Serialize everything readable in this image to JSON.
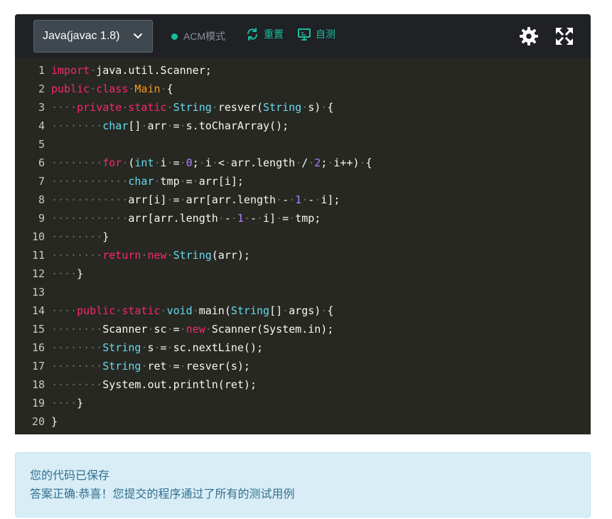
{
  "toolbar": {
    "language": "Java(javac 1.8)",
    "mode": "ACM模式",
    "reset_label": "重置",
    "selftest_label": "自测",
    "accent_color": "#1abc9c"
  },
  "editor": {
    "theme_background": "#272822",
    "lines": [
      {
        "n": "1",
        "html": "<span class=\"kw\">import</span><span class=\"ws\">·</span>java.util.Scanner;"
      },
      {
        "n": "2",
        "html": "<span class=\"kw\">public</span><span class=\"ws\">·</span><span class=\"kw\">class</span><span class=\"ws\">·</span><span class=\"cls\">Main</span><span class=\"ws\">·</span>{"
      },
      {
        "n": "3",
        "html": "<span class=\"ws\">····</span><span class=\"kw\">private</span><span class=\"ws\">·</span><span class=\"kw\">static</span><span class=\"ws\">·</span><span class=\"ty\">String</span><span class=\"ws\">·</span>resver(<span class=\"ty\">String</span><span class=\"ws\">·</span>s)<span class=\"ws\">·</span>{"
      },
      {
        "n": "4",
        "html": "<span class=\"ws\">········</span><span class=\"ty\">char</span>[]<span class=\"ws\">·</span>arr<span class=\"ws\">·</span>=<span class=\"ws\">·</span>s.toCharArray();"
      },
      {
        "n": "5",
        "html": ""
      },
      {
        "n": "6",
        "html": "<span class=\"ws\">········</span><span class=\"kw\">for</span><span class=\"ws\">·</span>(<span class=\"ty\">int</span><span class=\"ws\">·</span>i<span class=\"ws\">·</span>=<span class=\"ws\">·</span><span class=\"num\">0</span>;<span class=\"ws\">·</span>i<span class=\"ws\">·</span>&lt;<span class=\"ws\">·</span>arr.length<span class=\"ws\">·</span>/<span class=\"ws\">·</span><span class=\"num\">2</span>;<span class=\"ws\">·</span>i++)<span class=\"ws\">·</span>{"
      },
      {
        "n": "7",
        "html": "<span class=\"ws\">············</span><span class=\"ty\">char</span><span class=\"ws\">·</span>tmp<span class=\"ws\">·</span>=<span class=\"ws\">·</span>arr[i];"
      },
      {
        "n": "8",
        "html": "<span class=\"ws\">············</span>arr[i]<span class=\"ws\">·</span>=<span class=\"ws\">·</span>arr[arr.length<span class=\"ws\">·</span>-<span class=\"ws\">·</span><span class=\"num\">1</span><span class=\"ws\">·</span>-<span class=\"ws\">·</span>i];"
      },
      {
        "n": "9",
        "html": "<span class=\"ws\">············</span>arr[arr.length<span class=\"ws\">·</span>-<span class=\"ws\">·</span><span class=\"num\">1</span><span class=\"ws\">·</span>-<span class=\"ws\">·</span>i]<span class=\"ws\">·</span>=<span class=\"ws\">·</span>tmp;"
      },
      {
        "n": "10",
        "html": "<span class=\"ws\">········</span>}"
      },
      {
        "n": "11",
        "html": "<span class=\"ws\">········</span><span class=\"kw\">return</span><span class=\"ws\">·</span><span class=\"kw\">new</span><span class=\"ws\">·</span><span class=\"ty\">String</span>(arr);"
      },
      {
        "n": "12",
        "html": "<span class=\"ws\">····</span>}"
      },
      {
        "n": "13",
        "html": ""
      },
      {
        "n": "14",
        "html": "<span class=\"ws\">····</span><span class=\"kw\">public</span><span class=\"ws\">·</span><span class=\"kw\">static</span><span class=\"ws\">·</span><span class=\"ty\">void</span><span class=\"ws\">·</span>main(<span class=\"ty\">String</span>[]<span class=\"ws\">·</span>args)<span class=\"ws\">·</span>{"
      },
      {
        "n": "15",
        "html": "<span class=\"ws\">········</span>Scanner<span class=\"ws\">·</span>sc<span class=\"ws\">·</span>=<span class=\"ws\">·</span><span class=\"kw\">new</span><span class=\"ws\">·</span>Scanner(System.in);"
      },
      {
        "n": "16",
        "html": "<span class=\"ws\">········</span><span class=\"ty\">String</span><span class=\"ws\">·</span>s<span class=\"ws\">·</span>=<span class=\"ws\">·</span>sc.nextLine();"
      },
      {
        "n": "17",
        "html": "<span class=\"ws\">········</span><span class=\"ty\">String</span><span class=\"ws\">·</span>ret<span class=\"ws\">·</span>=<span class=\"ws\">·</span>resver(s);"
      },
      {
        "n": "18",
        "html": "<span class=\"ws\">········</span>System.out.println(ret);"
      },
      {
        "n": "19",
        "html": "<span class=\"ws\">····</span>}"
      },
      {
        "n": "20",
        "html": "}"
      }
    ]
  },
  "result": {
    "saved_text": "您的代码已保存",
    "verdict_text": "答案正确:恭喜！您提交的程序通过了所有的测试用例"
  }
}
